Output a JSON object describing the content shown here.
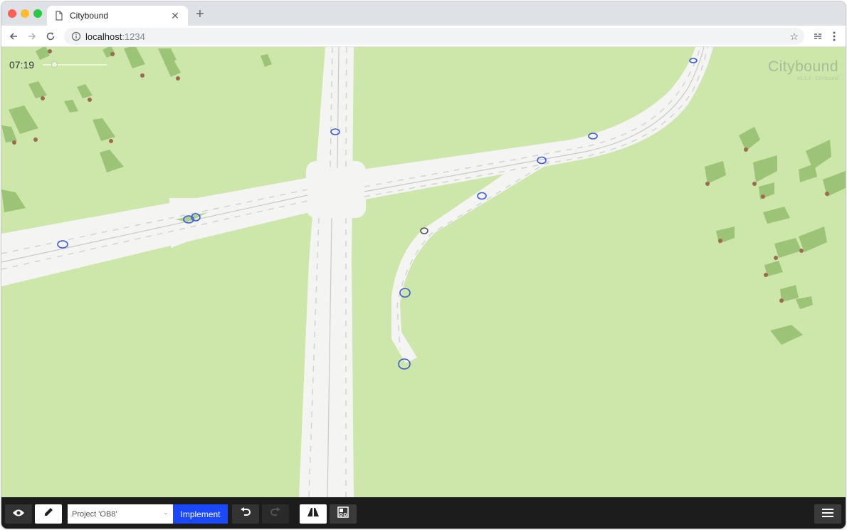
{
  "browser": {
    "tab_title": "Citybound",
    "url_host": "localhost",
    "url_port": ":1234",
    "new_tab_symbol": "+",
    "close_symbol": "✕"
  },
  "game": {
    "clock": "07:19",
    "brand_name": "Citybound",
    "brand_version": "v0.1.3 · CitYbound",
    "colors": {
      "grass": "#cde6a9",
      "road": "#f4f4f2",
      "lane_marking": "#d3d3d3",
      "tree": "#9cc476",
      "trunk": "#9d6a4f",
      "car_marker": "#3b5bd6"
    }
  },
  "bottombar": {
    "project_label": "Project 'OB8'",
    "implement_label": "Implement",
    "colors": {
      "implement": "#1a48ff",
      "bar": "#1c1c1c"
    }
  },
  "icons": {
    "tab": "page-icon",
    "info": "info-icon",
    "star": "bookmark-star-icon",
    "extension": "extension-icon",
    "menu": "vertical-dots-icon",
    "eye": "eye-icon",
    "pencil": "pencil-icon",
    "undo": "undo-icon",
    "redo": "redo-icon",
    "roads": "road-tool-icon",
    "zones": "zone-tool-icon",
    "hamburger": "hamburger-menu-icon"
  }
}
